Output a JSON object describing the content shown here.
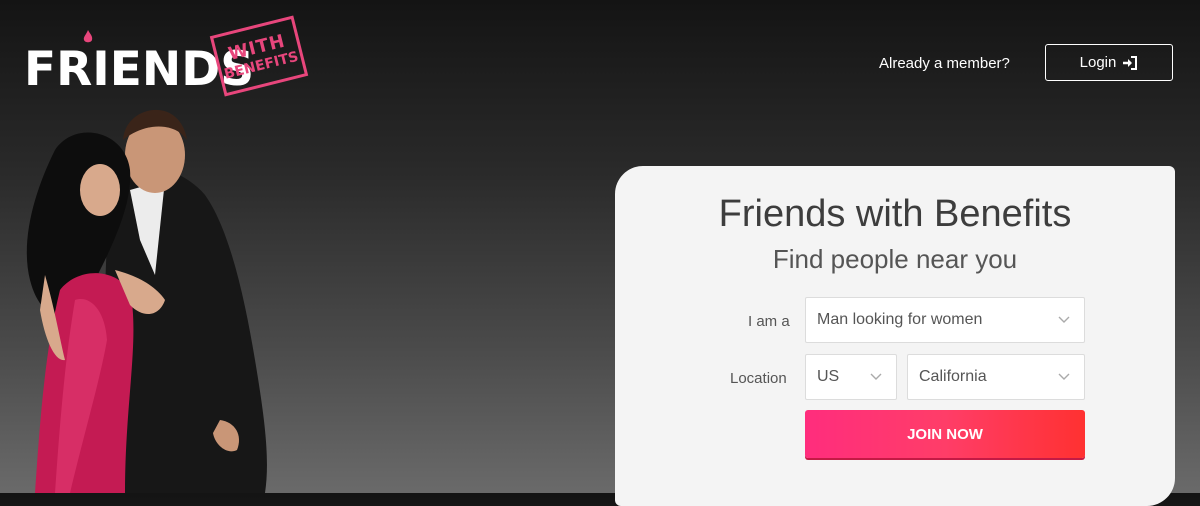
{
  "header": {
    "logo_text": "FRIENDS",
    "stamp_line1": "WITH",
    "stamp_line2": "BENEFITS",
    "member_text": "Already a member?",
    "login_label": "Login",
    "login_icon": "sign-in-icon"
  },
  "panel": {
    "title": "Friends with Benefits",
    "subtitle": "Find people near you",
    "i_am_label": "I am a",
    "i_am_value": "Man looking for women",
    "location_label": "Location",
    "country_value": "US",
    "region_value": "California",
    "join_label": "JOIN NOW"
  },
  "colors": {
    "accent": "#ff2d7d",
    "stamp": "#e8467c",
    "button_end": "#ff3131"
  }
}
